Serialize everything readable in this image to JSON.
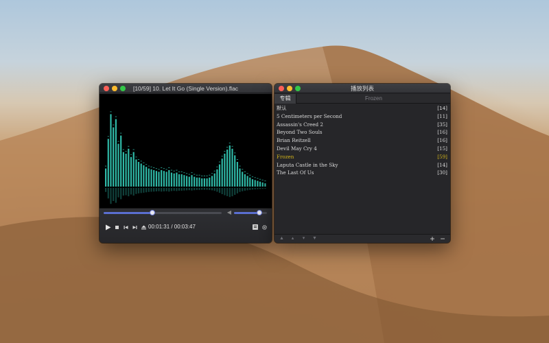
{
  "player": {
    "title": "[10/59] 10. Let It Go (Single Version).flac",
    "progress": 0.41,
    "volume": 0.78,
    "time": "00:01:31 / 00:03:47",
    "colors": {
      "accent": "#5b6fd1",
      "visualizer": "#2fb8a6"
    },
    "spectrum": [
      0.22,
      0.58,
      0.88,
      0.72,
      0.82,
      0.52,
      0.62,
      0.42,
      0.4,
      0.46,
      0.36,
      0.42,
      0.33,
      0.3,
      0.28,
      0.26,
      0.24,
      0.22,
      0.21,
      0.2,
      0.19,
      0.18,
      0.2,
      0.19,
      0.18,
      0.2,
      0.17,
      0.16,
      0.17,
      0.15,
      0.15,
      0.14,
      0.13,
      0.12,
      0.14,
      0.12,
      0.11,
      0.11,
      0.1,
      0.1,
      0.1,
      0.11,
      0.13,
      0.16,
      0.21,
      0.27,
      0.34,
      0.4,
      0.45,
      0.5,
      0.46,
      0.38,
      0.3,
      0.22,
      0.18,
      0.15,
      0.13,
      0.11,
      0.09,
      0.08,
      0.07,
      0.06,
      0.05,
      0.04
    ]
  },
  "playlist": {
    "title": "播放列表",
    "tab_album": "专辑",
    "tab_current": "Frozen",
    "rows": [
      {
        "name": "默认",
        "count": "[14]"
      },
      {
        "name": "5 Centimeters per Second",
        "count": "[11]"
      },
      {
        "name": "Assassin's Creed 2",
        "count": "[35]"
      },
      {
        "name": "Beyond Two Souls",
        "count": "[16]"
      },
      {
        "name": "Brian Reitzell",
        "count": "[16]"
      },
      {
        "name": "Devil May Cry 4",
        "count": "[15]"
      },
      {
        "name": "Frozen",
        "count": "[59]"
      },
      {
        "name": "Laputa Castle in the Sky",
        "count": "[14]"
      },
      {
        "name": "The Last Of Us",
        "count": "[30]"
      }
    ],
    "active_index": 6,
    "colors": {
      "active": "#d0b21a"
    },
    "add_label": "+",
    "remove_label": "−"
  }
}
